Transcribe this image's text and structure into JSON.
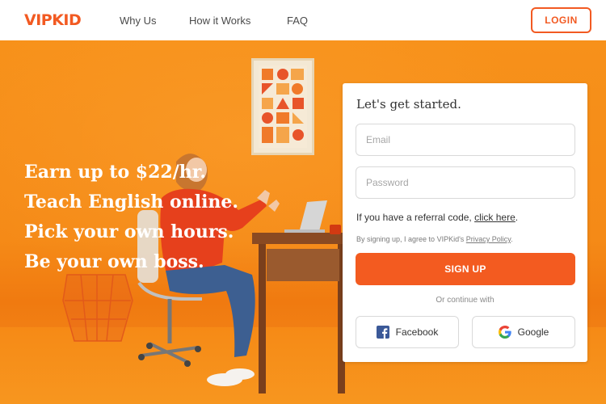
{
  "header": {
    "logo_text": "VIPKID",
    "nav": [
      "Why Us",
      "How it Works",
      "FAQ"
    ],
    "login_label": "LOGIN"
  },
  "hero": {
    "lines": [
      "Earn up to $22/hr.",
      "Teach English online.",
      "Pick your own hours.",
      "Be your own boss."
    ]
  },
  "form": {
    "title": "Let's get started.",
    "email_placeholder": "Email",
    "password_placeholder": "Password",
    "referral_text": "If you have a referral code, ",
    "referral_link": "click here",
    "referral_end": ".",
    "terms_text": "By signing up, I agree to VIPKid's ",
    "terms_link": "Privacy Policy",
    "terms_end": ".",
    "signup_label": "SIGN UP",
    "or_text": "Or continue with",
    "facebook_label": "Facebook",
    "google_label": "Google"
  },
  "colors": {
    "brand": "#f25a22",
    "hero_bg": "#f7911a",
    "signup_bg": "#f35b20",
    "facebook": "#3b5998"
  },
  "icons": [
    "facebook-icon",
    "google-icon"
  ]
}
